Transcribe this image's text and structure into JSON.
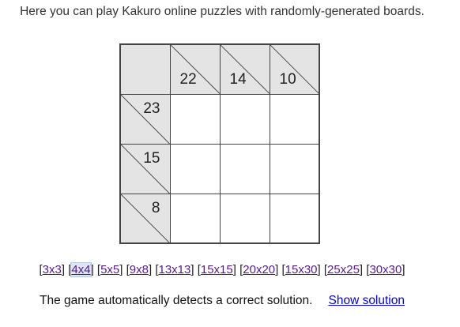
{
  "intro_text": "Here you can play Kakuro online puzzles with randomly-generated boards.",
  "board": {
    "column_clues": [
      "22",
      "14",
      "10"
    ],
    "row_clues": [
      "23",
      "15",
      "8"
    ]
  },
  "board_sizes": [
    "3x3",
    "4x4",
    "5x5",
    "9x8",
    "13x13",
    "15x15",
    "20x20",
    "15x30",
    "25x25",
    "30x30"
  ],
  "selected_size": "4x4",
  "footer": {
    "detect_text": "The game automatically detects a correct solution.",
    "show_solution_label": "Show solution"
  }
}
